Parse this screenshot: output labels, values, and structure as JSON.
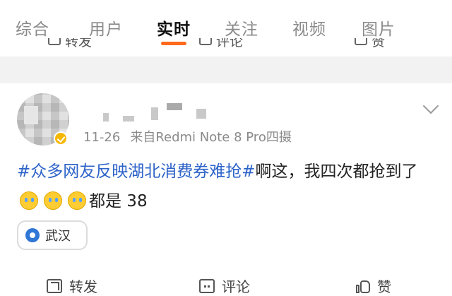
{
  "tabs": [
    {
      "label": "综合",
      "active": false
    },
    {
      "label": "用户",
      "active": false
    },
    {
      "label": "实时",
      "active": true
    },
    {
      "label": "关注",
      "active": false
    },
    {
      "label": "视频",
      "active": false
    },
    {
      "label": "图片",
      "active": false
    }
  ],
  "prev_post_actions": {
    "repost_label": "转发",
    "comment_label": "评论",
    "like_label": "赞"
  },
  "post": {
    "time": "11-26",
    "source": "来自Redmi Note 8 Pro四摄",
    "hashtag": "#众多网友反映湖北消费券难抢#",
    "text_before_emoji": "啊这，我四次都抢到了",
    "text_after_emoji": "都是 38",
    "emoji_icon": "laugh-cry-emoji",
    "emoji_count": 3,
    "location": "武汉",
    "actions": {
      "repost_label": "转发",
      "comment_label": "评论",
      "like_label": "赞"
    }
  },
  "colors": {
    "accent": "#ff6a1c",
    "hashtag": "#2d63c8",
    "location_pin": "#2f76d6"
  }
}
